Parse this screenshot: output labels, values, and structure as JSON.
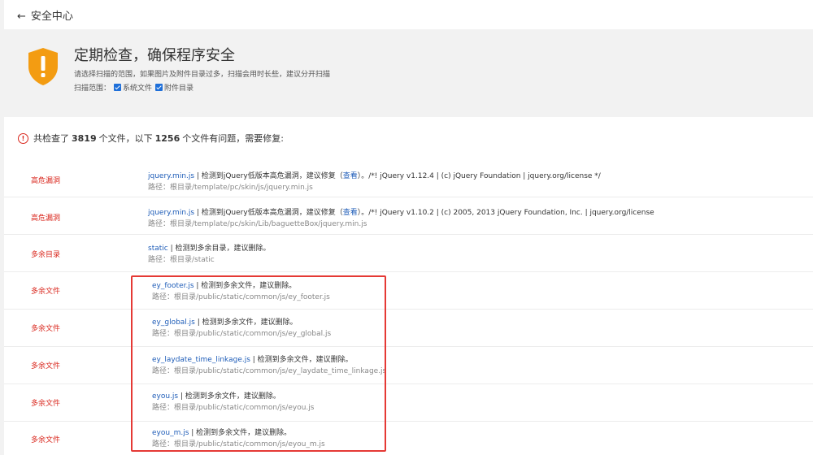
{
  "topbar": {
    "back_label": "安全中心"
  },
  "hero": {
    "title": "定期检查，确保程序安全",
    "description": "请选择扫描的范围，如果图片及附件目录过多，扫描会用时长些，建议分开扫描",
    "scope_label": "扫描范围：",
    "scope_options": [
      {
        "label": "系统文件",
        "checked": true
      },
      {
        "label": "附件目录",
        "checked": true
      }
    ]
  },
  "summary": {
    "prefix": "共检查了",
    "checked_count": "3819",
    "middle": "个文件，以下",
    "issue_count": "1256",
    "suffix": "个文件有问题，需要修复:"
  },
  "rows": [
    {
      "type": "高危漏洞",
      "name": "jquery.min.js",
      "message": " | 检测到jQuery低版本高危漏洞，建议修复（",
      "link": "查看",
      "extra": "）。/*! jQuery v1.12.4 | (c) jQuery Foundation | jquery.org/license */",
      "path": "路径：根目录/template/pc/skin/js/jquery.min.js"
    },
    {
      "type": "高危漏洞",
      "name": "jquery.min.js",
      "message": " | 检测到jQuery低版本高危漏洞，建议修复（",
      "link": "查看",
      "extra": "）。/*! jQuery v1.10.2 | (c) 2005, 2013 jQuery Foundation, Inc. | jquery.org/license",
      "path": "路径：根目录/template/pc/skin/Lib/baguetteBox/jquery.min.js"
    },
    {
      "type": "多余目录",
      "name": "static",
      "message": " | 检测到多余目录，建议删除。",
      "link": "",
      "extra": "",
      "path": "路径：根目录/static"
    },
    {
      "type": "多余文件",
      "name": "ey_footer.js",
      "message": " | 检测到多余文件，建议删除。",
      "link": "",
      "extra": "",
      "path": "路径：根目录/public/static/common/js/ey_footer.js"
    },
    {
      "type": "多余文件",
      "name": "ey_global.js",
      "message": " | 检测到多余文件，建议删除。",
      "link": "",
      "extra": "",
      "path": "路径：根目录/public/static/common/js/ey_global.js"
    },
    {
      "type": "多余文件",
      "name": "ey_laydate_time_linkage.js",
      "message": " | 检测到多余文件，建议删除。",
      "link": "",
      "extra": "",
      "path": "路径：根目录/public/static/common/js/ey_laydate_time_linkage.js"
    },
    {
      "type": "多余文件",
      "name": "eyou.js",
      "message": " | 检测到多余文件，建议删除。",
      "link": "",
      "extra": "",
      "path": "路径：根目录/public/static/common/js/eyou.js"
    },
    {
      "type": "多余文件",
      "name": "eyou_m.js",
      "message": " | 检测到多余文件，建议删除。",
      "link": "",
      "extra": "",
      "path": "路径：根目录/public/static/common/js/eyou_m.js"
    }
  ],
  "colors": {
    "danger": "#d9261c",
    "link": "#1f5db8",
    "shield": "#f39c12",
    "highlight": "#e53935"
  }
}
